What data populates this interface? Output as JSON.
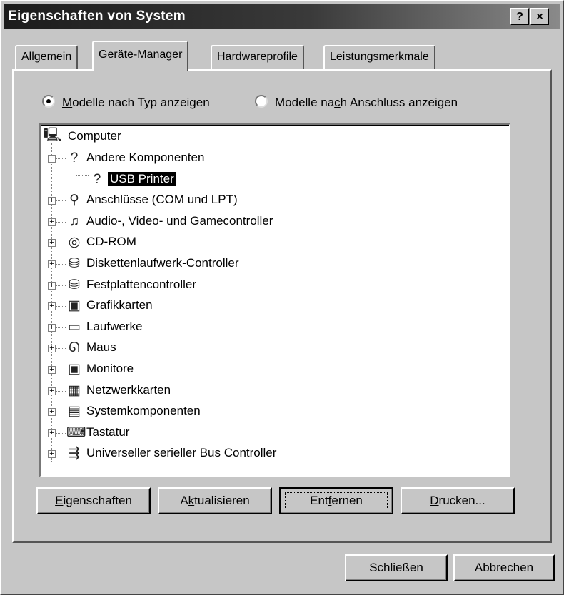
{
  "window": {
    "title": "Eigenschaften von System",
    "help_label": "?",
    "close_label": "×"
  },
  "tabs": [
    {
      "label": "Allgemein"
    },
    {
      "label": "Geräte-Manager",
      "active": true
    },
    {
      "label": "Hardwareprofile"
    },
    {
      "label": "Leistungsmerkmale"
    }
  ],
  "view_mode": {
    "by_type": {
      "label_pre": "",
      "label_u": "M",
      "label_post": "odelle nach Typ anzeigen",
      "selected": true
    },
    "by_connection": {
      "label_pre": "Modelle na",
      "label_u": "c",
      "label_post": "h Anschluss anzeigen",
      "selected": false
    }
  },
  "tree": {
    "root": {
      "label": "Computer",
      "icon": "computer-icon",
      "glyph": "🖳"
    },
    "items": [
      {
        "label": "Andere Komponenten",
        "icon": "unknown-device-icon",
        "glyph": "?",
        "expanded": true
      },
      {
        "label": "USB Printer",
        "icon": "unknown-device-icon",
        "glyph": "?",
        "child": true,
        "selected": true
      },
      {
        "label": "Anschlüsse (COM und LPT)",
        "icon": "port-icon",
        "glyph": "⚲"
      },
      {
        "label": "Audio-, Video- und Gamecontroller",
        "icon": "multimedia-icon",
        "glyph": "♫"
      },
      {
        "label": "CD-ROM",
        "icon": "cdrom-icon",
        "glyph": "◎"
      },
      {
        "label": "Diskettenlaufwerk-Controller",
        "icon": "floppy-controller-icon",
        "glyph": "⛁"
      },
      {
        "label": "Festplattencontroller",
        "icon": "disk-controller-icon",
        "glyph": "⛁"
      },
      {
        "label": "Grafikkarten",
        "icon": "display-adapter-icon",
        "glyph": "▣"
      },
      {
        "label": "Laufwerke",
        "icon": "drive-icon",
        "glyph": "▭"
      },
      {
        "label": "Maus",
        "icon": "mouse-icon",
        "glyph": "ᘏ"
      },
      {
        "label": "Monitore",
        "icon": "monitor-icon",
        "glyph": "▣"
      },
      {
        "label": "Netzwerkkarten",
        "icon": "network-card-icon",
        "glyph": "▦"
      },
      {
        "label": "Systemkomponenten",
        "icon": "system-device-icon",
        "glyph": "▤"
      },
      {
        "label": "Tastatur",
        "icon": "keyboard-icon",
        "glyph": "⌨"
      },
      {
        "label": "Universeller serieller Bus Controller",
        "icon": "usb-icon",
        "glyph": "⇶"
      }
    ]
  },
  "panel_buttons": [
    {
      "pre": "",
      "u": "E",
      "post": "igenschaften"
    },
    {
      "pre": "A",
      "u": "k",
      "post": "tualisieren"
    },
    {
      "pre": "Ent",
      "u": "f",
      "post": "ernen",
      "default": true
    },
    {
      "pre": "",
      "u": "D",
      "post": "rucken..."
    }
  ],
  "dialog_buttons": {
    "close": "Schließen",
    "cancel": "Abbrechen"
  }
}
